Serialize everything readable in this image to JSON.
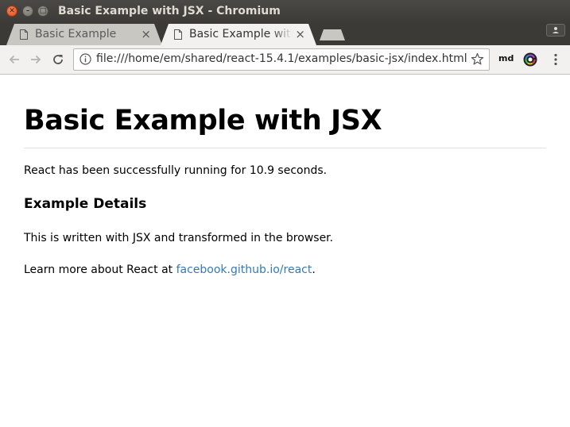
{
  "window": {
    "title": "Basic Example with JSX - Chromium"
  },
  "tabs": [
    {
      "label": "Basic Example",
      "close": "×"
    },
    {
      "label": "Basic Example with JSX",
      "close": "×"
    }
  ],
  "address_bar": {
    "url": "file:///home/em/shared/react-15.4.1/examples/basic-jsx/index.html"
  },
  "extensions": {
    "md_label": "md"
  },
  "page": {
    "heading": "Basic Example with JSX",
    "running_text": "React has been successfully running for 10.9 seconds.",
    "details_heading": "Example Details",
    "details_text": "This is written with JSX and transformed in the browser.",
    "learn_more_prefix": "Learn more about React at ",
    "learn_more_link": "facebook.github.io/react",
    "learn_more_suffix": "."
  },
  "colors": {
    "link": "#337ab7",
    "titlebar": "#3b3a37",
    "close_button": "#e0491c"
  }
}
